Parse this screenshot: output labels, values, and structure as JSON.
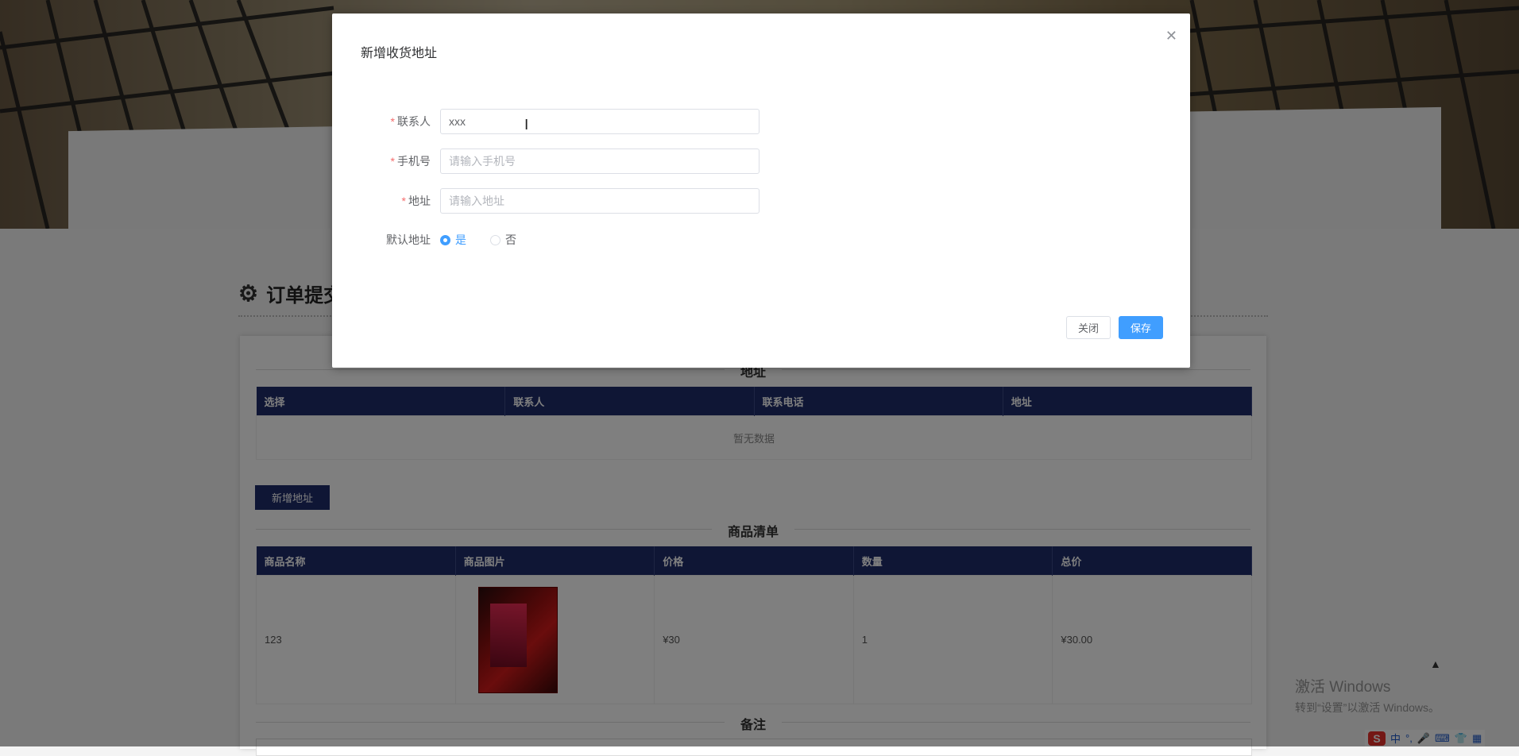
{
  "page": {
    "section_title": "订单提交",
    "address_heading": "地址",
    "address_table": {
      "headers": [
        "选择",
        "联系人",
        "联系电话",
        "地址"
      ],
      "empty_text": "暂无数据"
    },
    "add_address_button": "新增地址",
    "goods_heading": "商品清单",
    "goods_table": {
      "headers": [
        "商品名称",
        "商品图片",
        "价格",
        "数量",
        "总价"
      ],
      "rows": [
        {
          "name": "123",
          "price": "¥30",
          "quantity": "1",
          "total": "¥30.00"
        }
      ]
    },
    "remark_heading": "备注",
    "back_to_top_icon": "caret-up-icon"
  },
  "modal": {
    "title": "新增收货地址",
    "fields": {
      "contact": {
        "label": "联系人",
        "value": "xxx",
        "required": true
      },
      "phone": {
        "label": "手机号",
        "placeholder": "请输入手机号",
        "required": true
      },
      "address": {
        "label": "地址",
        "placeholder": "请输入地址",
        "required": true
      },
      "default": {
        "label": "默认地址",
        "options": [
          "是",
          "否"
        ],
        "selected": "是"
      }
    },
    "buttons": {
      "close": "关闭",
      "save": "保存"
    },
    "close_icon": "close-icon"
  },
  "watermark": {
    "line1": "激活 Windows",
    "line2": "转到“设置”以激活 Windows。"
  },
  "taskbar": {
    "ime_text": "中",
    "ime_logo": "S"
  },
  "colors": {
    "table_header": "#1f2d6b",
    "primary_button": "#409eff",
    "required_mark": "#f56c6c"
  }
}
